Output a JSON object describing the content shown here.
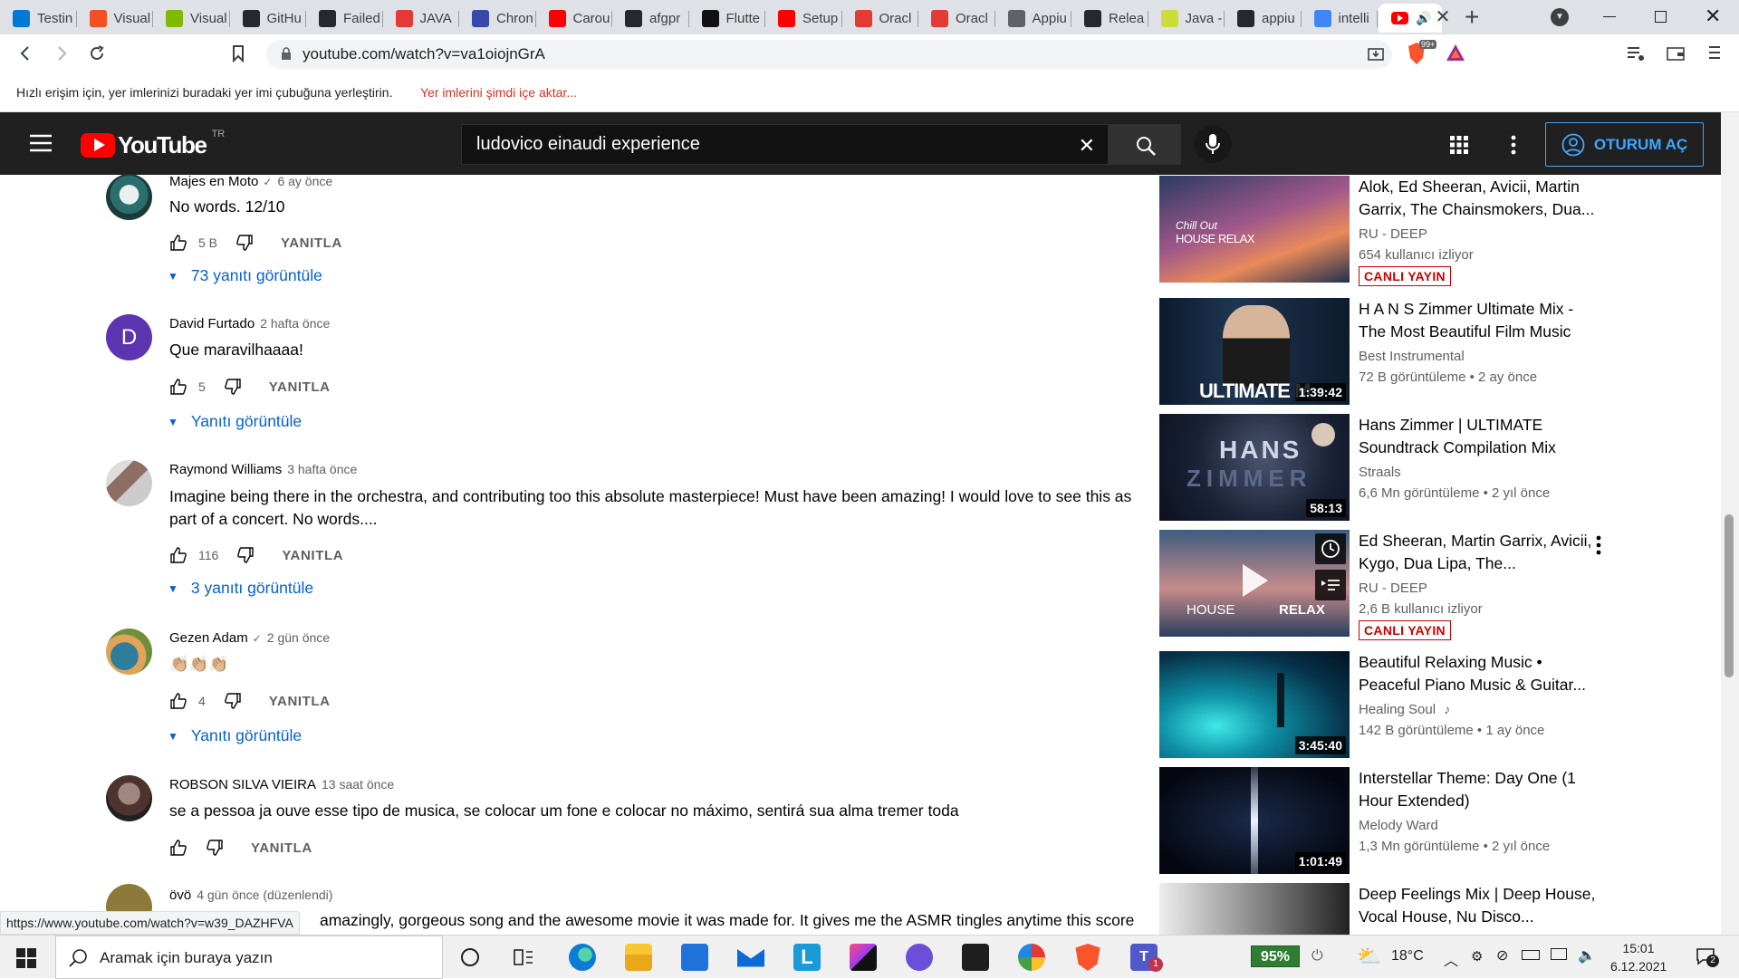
{
  "browser": {
    "tabs": [
      {
        "label": "Testin",
        "color": "#0078d4"
      },
      {
        "label": "Visual",
        "color": "#f25022"
      },
      {
        "label": "Visual",
        "color": "#7fba00"
      },
      {
        "label": "GitHu",
        "color": "#24292e"
      },
      {
        "label": "Failed",
        "color": "#24292e"
      },
      {
        "label": "JAVA",
        "color": "#e53935"
      },
      {
        "label": "Chron",
        "color": "#3949ab"
      },
      {
        "label": "Carou",
        "color": "#ff0000"
      },
      {
        "label": "afgpr",
        "color": "#24292e"
      },
      {
        "label": "Flutte",
        "color": "#111111"
      },
      {
        "label": "Setup",
        "color": "#ff0000"
      },
      {
        "label": "Oracl",
        "color": "#e53935"
      },
      {
        "label": "Oracl",
        "color": "#e53935"
      },
      {
        "label": "Appiu",
        "color": "#5f6368"
      },
      {
        "label": "Relea",
        "color": "#24292e"
      },
      {
        "label": "Java -",
        "color": "#cddc39"
      },
      {
        "label": "appiu",
        "color": "#24292e"
      },
      {
        "label": "intelli",
        "color": "#4285f4"
      }
    ],
    "url": "youtube.com/watch?v=va1oiojnGrA",
    "bookmark_hint": "Hızlı erişim için, yer imlerinizi buradaki yer imi çubuğuna yerleştirin.",
    "bookmark_import": "Yer imlerini şimdi içe aktar...",
    "brave_badge": "99+",
    "status_url": "https://www.youtube.com/watch?v=w39_DAZHFVA"
  },
  "youtube": {
    "logo_text": "YouTube",
    "country": "TR",
    "search_value": "ludovico einaudi experience",
    "signin_label": "OTURUM AÇ",
    "colors": {
      "brand": "#ff0000",
      "link": "#065fd4",
      "live": "#cc0000"
    }
  },
  "comments": [
    {
      "author": "Majes en Moto",
      "verified": true,
      "time": "6 ay önce",
      "text": "No words. 12/10",
      "likes": "5 B",
      "reply": "YANITLA",
      "replies": "73 yanıtı görüntüle"
    },
    {
      "author": "David Furtado",
      "verified": false,
      "time": "2 hafta önce",
      "text": "Que maravilhaaaa!",
      "likes": "5",
      "reply": "YANITLA",
      "replies": "Yanıtı görüntüle",
      "avatar_letter": "D"
    },
    {
      "author": "Raymond Williams",
      "verified": false,
      "time": "3 hafta önce",
      "text": "Imagine being there in the orchestra, and contributing too this absolute masterpiece! Must have been amazing!  I would love to see this as part of a concert.  No words....",
      "likes": "116",
      "reply": "YANITLA",
      "replies": "3 yanıtı görüntüle"
    },
    {
      "author": "Gezen Adam",
      "verified": true,
      "time": "2 gün önce",
      "text": "👏🏼👏🏼👏🏼",
      "likes": "4",
      "reply": "YANITLA",
      "replies": "Yanıtı görüntüle"
    },
    {
      "author": "ROBSON SILVA VIEIRA",
      "verified": false,
      "time": "13 saat önce",
      "text": "se a pessoa ja ouve esse tipo de musica, se colocar um fone e colocar no máximo, sentirá sua alma tremer toda",
      "likes": "",
      "reply": "YANITLA"
    },
    {
      "author": "övö",
      "verified": false,
      "time": "4 gün önce (düzenlendi)",
      "text": "amazingly, gorgeous song and the awesome movie it was made for. It gives me the ASMR tingles anytime this score"
    }
  ],
  "sidebar": [
    {
      "title": "Alok, Ed Sheeran, Avicii, Martin Garrix, The Chainsmokers, Dua...",
      "channel": "RU - DEEP",
      "meta": "654 kullanıcı izliyor",
      "badge": "CANLI YAYIN",
      "thumb_text_1": "Chill Out",
      "thumb_text_2": "HOUSE RELAX"
    },
    {
      "title": "H A N S Zimmer Ultimate Mix - The Most Beautiful Film Music",
      "channel": "Best Instrumental",
      "meta": "72 B görüntüleme • 2 ay önce",
      "duration": "1:39:42",
      "thumb_text_1": "ULTIMATE M"
    },
    {
      "title": "Hans Zimmer | ULTIMATE Soundtrack Compilation Mix",
      "channel": "Straals",
      "meta": "6,6 Mn görüntüleme • 2 yıl önce",
      "duration": "58:13",
      "thumb_text_1": "HANS",
      "thumb_text_2": "ZIMMER"
    },
    {
      "title": "Ed Sheeran, Martin Garrix, Avicii, Kygo, Dua Lipa, The...",
      "channel": "RU - DEEP",
      "meta": "2,6 B kullanıcı izliyor",
      "badge": "CANLI YAYIN",
      "thumb_text_1": "HOUSE",
      "thumb_text_2": "RELAX"
    },
    {
      "title": "Beautiful Relaxing Music • Peaceful Piano Music & Guitar...",
      "channel": "Healing Soul",
      "meta": "142 B görüntüleme • 1 ay önce",
      "duration": "3:45:40"
    },
    {
      "title": "Interstellar Theme: Day One (1 Hour Extended)",
      "channel": "Melody Ward",
      "meta": "1,3 Mn görüntüleme • 2 yıl önce",
      "duration": "1:01:49"
    },
    {
      "title": "Deep Feelings Mix | Deep House, Vocal House, Nu Disco..."
    }
  ],
  "taskbar": {
    "search_placeholder": "Aramak için buraya yazın",
    "battery": "95%",
    "temperature": "18°C",
    "time": "15:01",
    "date": "6.12.2021",
    "notification_count": "2",
    "teams_badge": "1"
  }
}
